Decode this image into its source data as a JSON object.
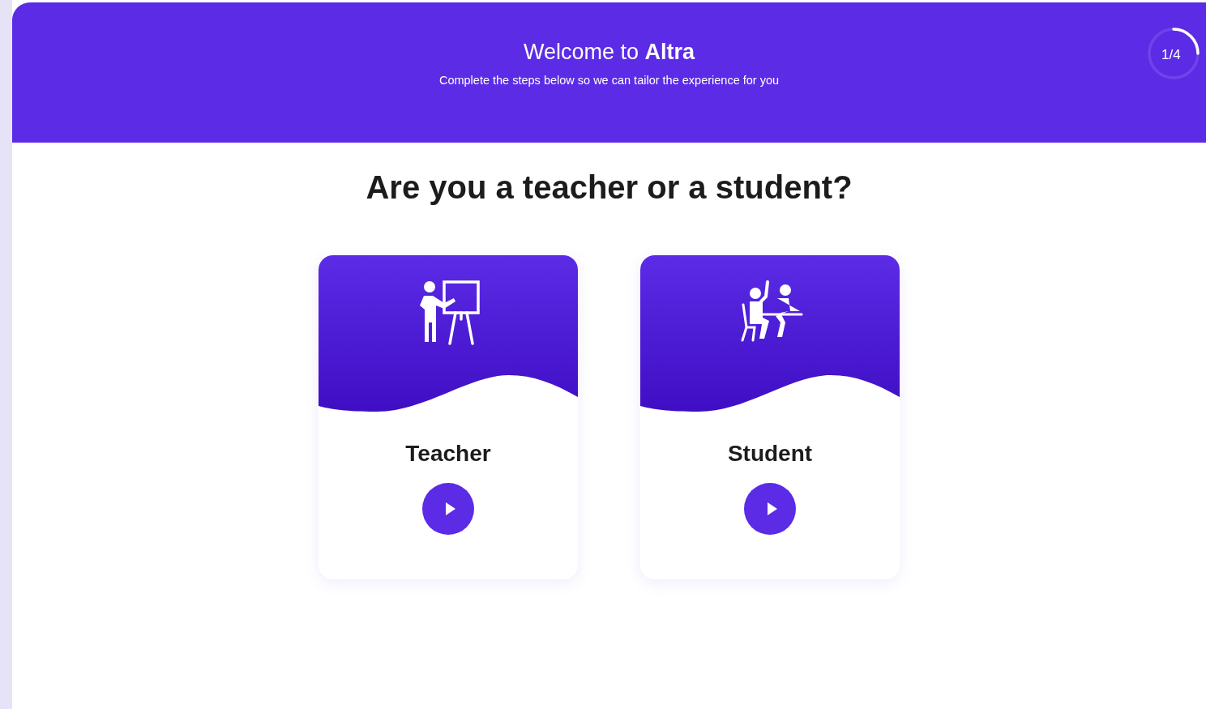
{
  "header": {
    "title": "Welcome to **Altra**",
    "subtitle": "Complete the steps below so we can tailor the experience for you",
    "progress": {
      "label": "1/4",
      "level": 0.25
    }
  },
  "question": "Are you a teacher or a student?",
  "options": [
    {
      "label": "Teacher",
      "kind": "teacher"
    },
    {
      "label": "Student",
      "kind": "student"
    }
  ]
}
